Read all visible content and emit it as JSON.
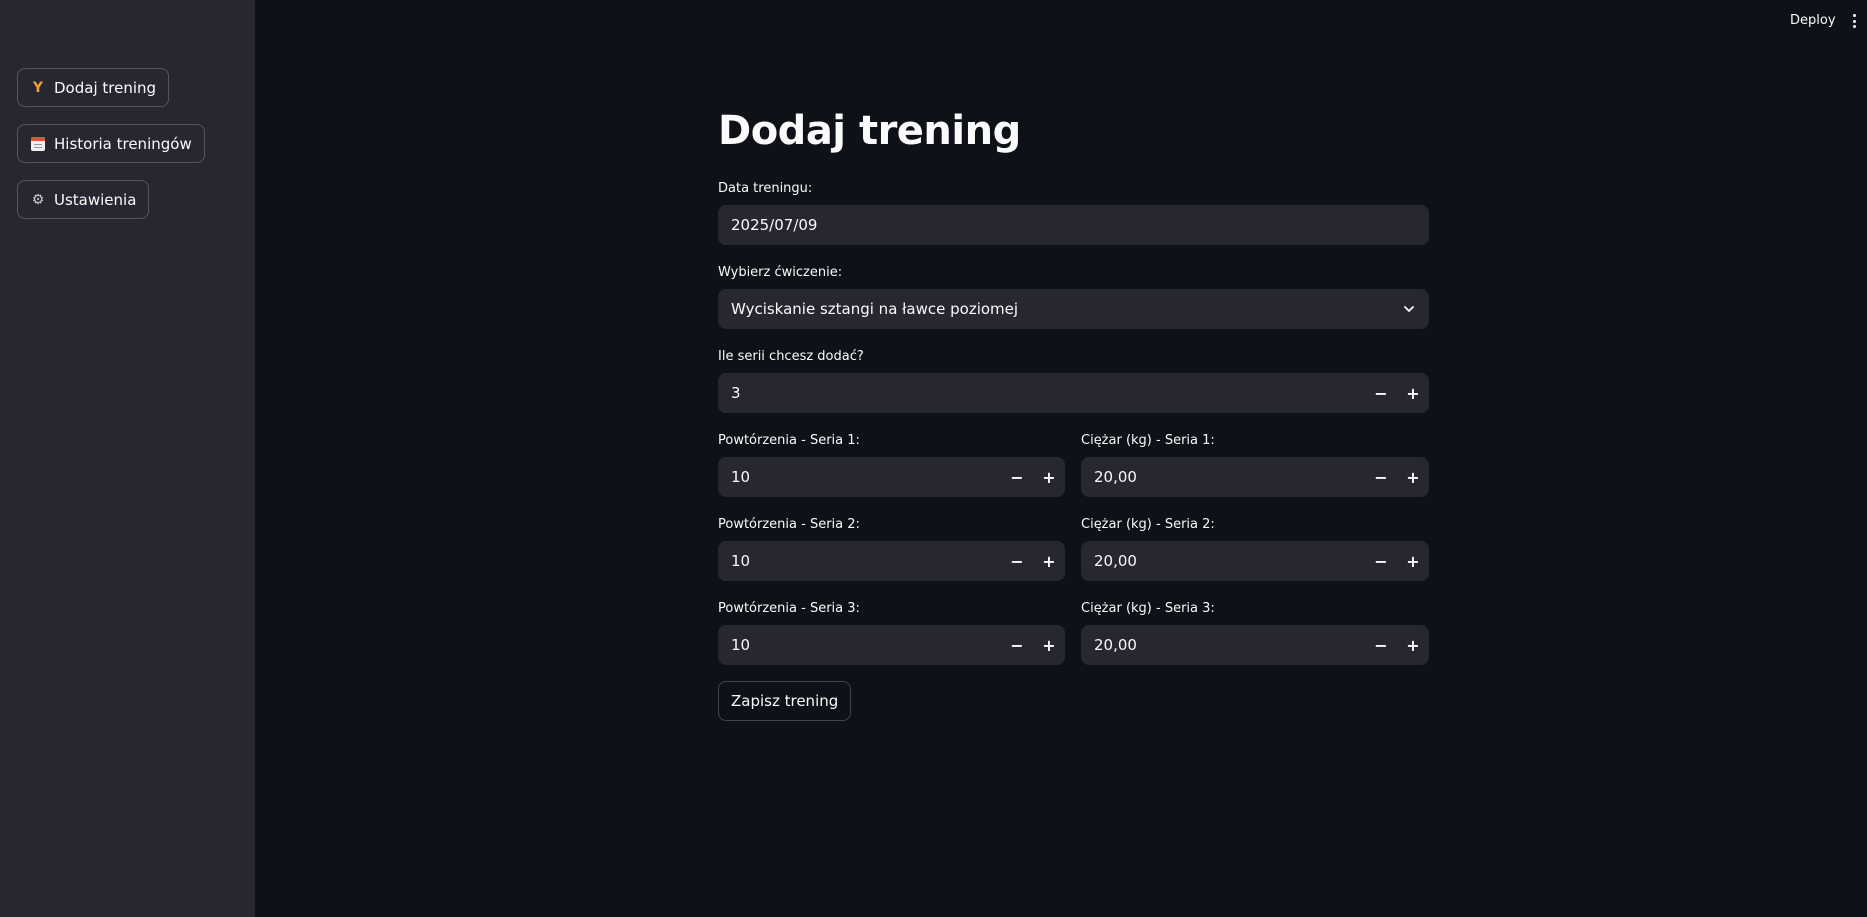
{
  "sidebar": {
    "items": [
      {
        "label": "Dodaj trening",
        "icon": "dumbbell-icon"
      },
      {
        "label": "Historia treningów",
        "icon": "calendar-icon"
      },
      {
        "label": "Ustawienia",
        "icon": "gear-icon"
      }
    ]
  },
  "topbar": {
    "deploy_label": "Deploy",
    "menu_icon": "kebab-menu-icon"
  },
  "main": {
    "title": "Dodaj trening",
    "date": {
      "label": "Data treningu:",
      "value": "2025/07/09"
    },
    "exercise": {
      "label": "Wybierz ćwiczenie:",
      "value": "Wyciskanie sztangi na ławce poziomej"
    },
    "series_count": {
      "label": "Ile serii chcesz dodać?",
      "value": "3"
    },
    "series": [
      {
        "reps_label": "Powtórzenia - Seria 1:",
        "reps_value": "10",
        "weight_label": "Ciężar (kg) - Seria 1:",
        "weight_value": "20,00"
      },
      {
        "reps_label": "Powtórzenia - Seria 2:",
        "reps_value": "10",
        "weight_label": "Ciężar (kg) - Seria 2:",
        "weight_value": "20,00"
      },
      {
        "reps_label": "Powtórzenia - Seria 3:",
        "reps_value": "10",
        "weight_label": "Ciężar (kg) - Seria 3:",
        "weight_value": "20,00"
      }
    ],
    "stepper_minus": "−",
    "stepper_plus": "+",
    "save_label": "Zapisz trening"
  },
  "colors": {
    "background": "#0e1117",
    "sidebar": "#262730",
    "field": "#262730",
    "text": "#fafafa"
  }
}
